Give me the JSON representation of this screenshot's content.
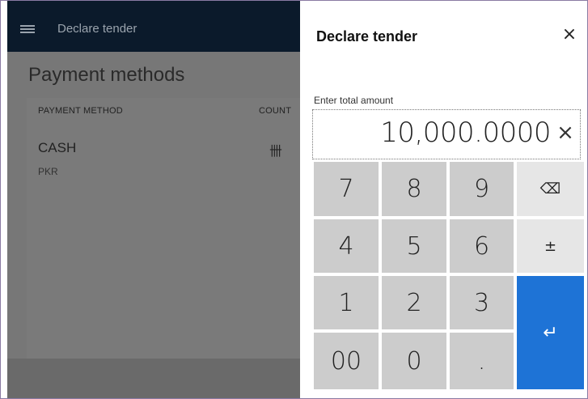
{
  "app": {
    "topbar_title": "Declare tender",
    "page_title": "Payment methods",
    "columns": {
      "method": "PAYMENT METHOD",
      "count": "COUNT"
    },
    "rows": [
      {
        "name": "CASH",
        "currency": "PKR",
        "count_icon": "tally-icon"
      }
    ]
  },
  "dialog": {
    "title": "Declare tender",
    "close_symbol": "×",
    "amount_label": "Enter total amount",
    "amount_value": "10,000.0000",
    "clear_symbol": "×"
  },
  "keypad": {
    "k7": "7",
    "k8": "8",
    "k9": "9",
    "backspace": "⌫",
    "k4": "4",
    "k5": "5",
    "k6": "6",
    "plusminus": "±",
    "k1": "1",
    "k2": "2",
    "k3": "3",
    "enter": "↵",
    "k00": "00",
    "k0": "0",
    "dot": "."
  },
  "colors": {
    "accent": "#1e73d6",
    "topbar": "#0b1a2b",
    "overlay": "#777777"
  }
}
